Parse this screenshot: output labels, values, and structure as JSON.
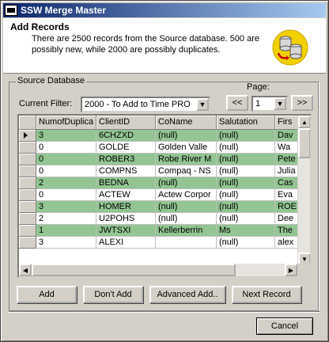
{
  "window": {
    "title": "SSW Merge Master"
  },
  "header": {
    "title": "Add Records",
    "description": "There are 2500 records from the Source database. 500 are possibly new, while 2000 are possibly duplicates.",
    "icon": "database-merge-icon"
  },
  "source_group": {
    "legend": "Source Database",
    "filter_label": "Current Filter:",
    "filter_value": "2000 - To Add to Time PRO",
    "page_label": "Page:",
    "page_value": "1",
    "prev_label": "<<",
    "next_label": ">>"
  },
  "grid": {
    "columns": [
      "NumofDuplica",
      "ClientID",
      "CoName",
      "Salutation",
      "Firs"
    ],
    "rows": [
      {
        "current": true,
        "green": true,
        "cells": [
          "3",
          "6CHZXD",
          "(null)",
          "(null)",
          "Dav"
        ]
      },
      {
        "current": false,
        "green": false,
        "cells": [
          "0",
          "GOLDE",
          "Golden Valle",
          "(null)",
          "Wa"
        ]
      },
      {
        "current": false,
        "green": true,
        "cells": [
          "0",
          "ROBER3",
          "Robe River M",
          "(null)",
          "Pete"
        ]
      },
      {
        "current": false,
        "green": false,
        "cells": [
          "0",
          "COMPNS",
          "Compaq - NS",
          "(null)",
          "Julia"
        ]
      },
      {
        "current": false,
        "green": true,
        "cells": [
          "2",
          "BEDNA",
          "(null)",
          "(null)",
          "Cas"
        ]
      },
      {
        "current": false,
        "green": false,
        "cells": [
          "0",
          "ACTEW",
          "Actew Corpor",
          "(null)",
          "Eva"
        ]
      },
      {
        "current": false,
        "green": true,
        "cells": [
          "3",
          "HOMER",
          "(null)",
          "(null)",
          "ROE"
        ]
      },
      {
        "current": false,
        "green": false,
        "cells": [
          "2",
          "U2POHS",
          "(null)",
          "(null)",
          "Dee"
        ]
      },
      {
        "current": false,
        "green": true,
        "cells": [
          "1",
          "JWTSXI",
          "Kellerberrin",
          "Ms",
          "The"
        ]
      },
      {
        "current": false,
        "green": false,
        "cells": [
          "3",
          "ALEXI",
          "",
          "(null)",
          "alex"
        ]
      }
    ]
  },
  "actions": {
    "add": "Add",
    "dont_add": "Don't Add",
    "advanced_add": "Advanced Add..",
    "next_record": "Next Record",
    "cancel": "Cancel"
  },
  "colors": {
    "duplicate_row": "#92c592",
    "titlebar": "#0a246a"
  }
}
